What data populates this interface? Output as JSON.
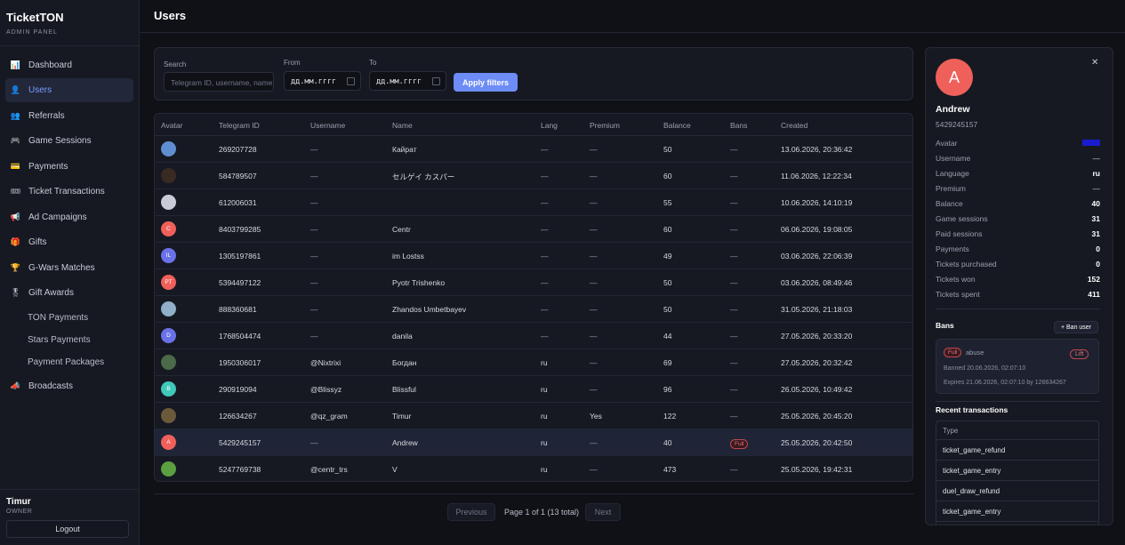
{
  "brand": {
    "title": "TicketTON",
    "subtitle": "ADMIN PANEL"
  },
  "nav": {
    "items": [
      {
        "label": "Dashboard",
        "icon": "📊"
      },
      {
        "label": "Users",
        "icon": "👤",
        "active": true
      },
      {
        "label": "Referrals",
        "icon": "👥"
      },
      {
        "label": "Game Sessions",
        "icon": "🎮"
      },
      {
        "label": "Payments",
        "icon": "💳"
      },
      {
        "label": "Ticket Transactions",
        "icon": "🎟"
      },
      {
        "label": "Ad Campaigns",
        "icon": "📢"
      },
      {
        "label": "Gifts",
        "icon": "🎁"
      },
      {
        "label": "G-Wars Matches",
        "icon": "🏆"
      },
      {
        "label": "Gift Awards",
        "icon": "🎖"
      }
    ],
    "sub_items": [
      "TON Payments",
      "Stars Payments",
      "Payment Packages"
    ],
    "broadcasts": {
      "label": "Broadcasts",
      "icon": "📣"
    }
  },
  "user": {
    "name": "Timur",
    "role": "OWNER",
    "logout": "Logout"
  },
  "page": {
    "title": "Users"
  },
  "filters": {
    "search_label": "Search",
    "search_placeholder": "Telegram ID, username, name",
    "from_label": "From",
    "from_value": "дд.мм.гггг",
    "to_label": "To",
    "to_value": "дд.мм.гггг",
    "apply": "Apply filters"
  },
  "table": {
    "columns": [
      "Avatar",
      "Telegram ID",
      "Username",
      "Name",
      "Lang",
      "Premium",
      "Balance",
      "Bans",
      "Created"
    ],
    "rows": [
      {
        "avatar_color": "#5f8fd0",
        "avatar_text": "",
        "id": "269207728",
        "username": "—",
        "name": "Кайрат",
        "lang": "—",
        "premium": "—",
        "balance": "50",
        "bans": "—",
        "created": "13.06.2026, 20:36:42"
      },
      {
        "avatar_color": "#3a2a24",
        "avatar_text": "",
        "id": "584789507",
        "username": "—",
        "name": "セルゲイ カスパー",
        "lang": "—",
        "premium": "—",
        "balance": "60",
        "bans": "—",
        "created": "11.06.2026, 12:22:34"
      },
      {
        "avatar_color": "#c9ccd6",
        "avatar_text": "",
        "id": "612006031",
        "username": "—",
        "name": "",
        "lang": "—",
        "premium": "—",
        "balance": "55",
        "bans": "—",
        "created": "10.06.2026, 14:10:19"
      },
      {
        "avatar_color": "#f0605a",
        "avatar_text": "C",
        "id": "8403799285",
        "username": "—",
        "name": "Centr",
        "lang": "—",
        "premium": "—",
        "balance": "60",
        "bans": "—",
        "created": "06.06.2026, 19:08:05"
      },
      {
        "avatar_color": "#6a72e8",
        "avatar_text": "IL",
        "id": "1305197861",
        "username": "—",
        "name": "im Lostss",
        "lang": "—",
        "premium": "—",
        "balance": "49",
        "bans": "—",
        "created": "03.06.2026, 22:06:39"
      },
      {
        "avatar_color": "#f0605a",
        "avatar_text": "PT",
        "id": "5394497122",
        "username": "—",
        "name": "Pyotr Trishenko",
        "lang": "—",
        "premium": "—",
        "balance": "50",
        "bans": "—",
        "created": "03.06.2026, 08:49:46"
      },
      {
        "avatar_color": "#8fb0c8",
        "avatar_text": "",
        "id": "888360681",
        "username": "—",
        "name": "Zhandos Umbetbayev",
        "lang": "—",
        "premium": "—",
        "balance": "50",
        "bans": "—",
        "created": "31.05.2026, 21:18:03"
      },
      {
        "avatar_color": "#6a72e8",
        "avatar_text": "D",
        "id": "1768504474",
        "username": "—",
        "name": "danila",
        "lang": "—",
        "premium": "—",
        "balance": "44",
        "bans": "—",
        "created": "27.05.2026, 20:33:20"
      },
      {
        "avatar_color": "#4a6a4a",
        "avatar_text": "",
        "id": "1950306017",
        "username": "@Nixtrixi",
        "name": "Богдан",
        "lang": "ru",
        "premium": "—",
        "balance": "69",
        "bans": "—",
        "created": "27.05.2026, 20:32:42"
      },
      {
        "avatar_color": "#3fc9b8",
        "avatar_text": "B",
        "id": "290919094",
        "username": "@Blissyz",
        "name": "Blissful",
        "lang": "ru",
        "premium": "—",
        "balance": "96",
        "bans": "—",
        "created": "26.05.2026, 10:49:42"
      },
      {
        "avatar_color": "#6a5a3a",
        "avatar_text": "",
        "id": "126634267",
        "username": "@qz_gram",
        "name": "Timur",
        "lang": "ru",
        "premium": "Yes",
        "balance": "122",
        "bans": "—",
        "created": "25.05.2026, 20:45:20"
      },
      {
        "avatar_color": "#f0605a",
        "avatar_text": "A",
        "id": "5429245157",
        "username": "—",
        "name": "Andrew",
        "lang": "ru",
        "premium": "—",
        "balance": "40",
        "bans": "Full",
        "created": "25.05.2026, 20:42:50",
        "selected": true
      },
      {
        "avatar_color": "#5aa040",
        "avatar_text": "",
        "id": "5247769738",
        "username": "@centr_trs",
        "name": "V",
        "lang": "ru",
        "premium": "—",
        "balance": "473",
        "bans": "—",
        "created": "25.05.2026, 19:42:31"
      }
    ]
  },
  "pagination": {
    "previous": "Previous",
    "text": "Page 1 of 1 (13 total)",
    "next": "Next"
  },
  "detail": {
    "avatar_letter": "A",
    "name": "Andrew",
    "id": "5429245157",
    "fields": [
      {
        "k": "Avatar",
        "v": ""
      },
      {
        "k": "Username",
        "v": "—"
      },
      {
        "k": "Language",
        "v": "ru"
      },
      {
        "k": "Premium",
        "v": "—"
      },
      {
        "k": "Balance",
        "v": "40"
      },
      {
        "k": "Game sessions",
        "v": "31"
      },
      {
        "k": "Paid sessions",
        "v": "31"
      },
      {
        "k": "Payments",
        "v": "0"
      },
      {
        "k": "Tickets purchased",
        "v": "0"
      },
      {
        "k": "Tickets won",
        "v": "152"
      },
      {
        "k": "Tickets spent",
        "v": "411"
      }
    ],
    "bans_title": "Bans",
    "ban_user": "+ Ban user",
    "ban": {
      "badge": "Full",
      "reason": "abuse",
      "lift": "Lift",
      "banned": "Banned 20.06.2026, 02:07:10",
      "expires": "Expires 21.06.2026, 02:07:10   by 126634267"
    },
    "tx_title": "Recent transactions",
    "tx_header": "Type",
    "tx_rows": [
      "ticket_game_refund",
      "ticket_game_entry",
      "duel_draw_refund",
      "ticket_game_entry"
    ]
  },
  "colors": {
    "accent": "#6d8cf6",
    "danger": "#e07077",
    "bg": "#0f1117",
    "panel": "#161922"
  }
}
